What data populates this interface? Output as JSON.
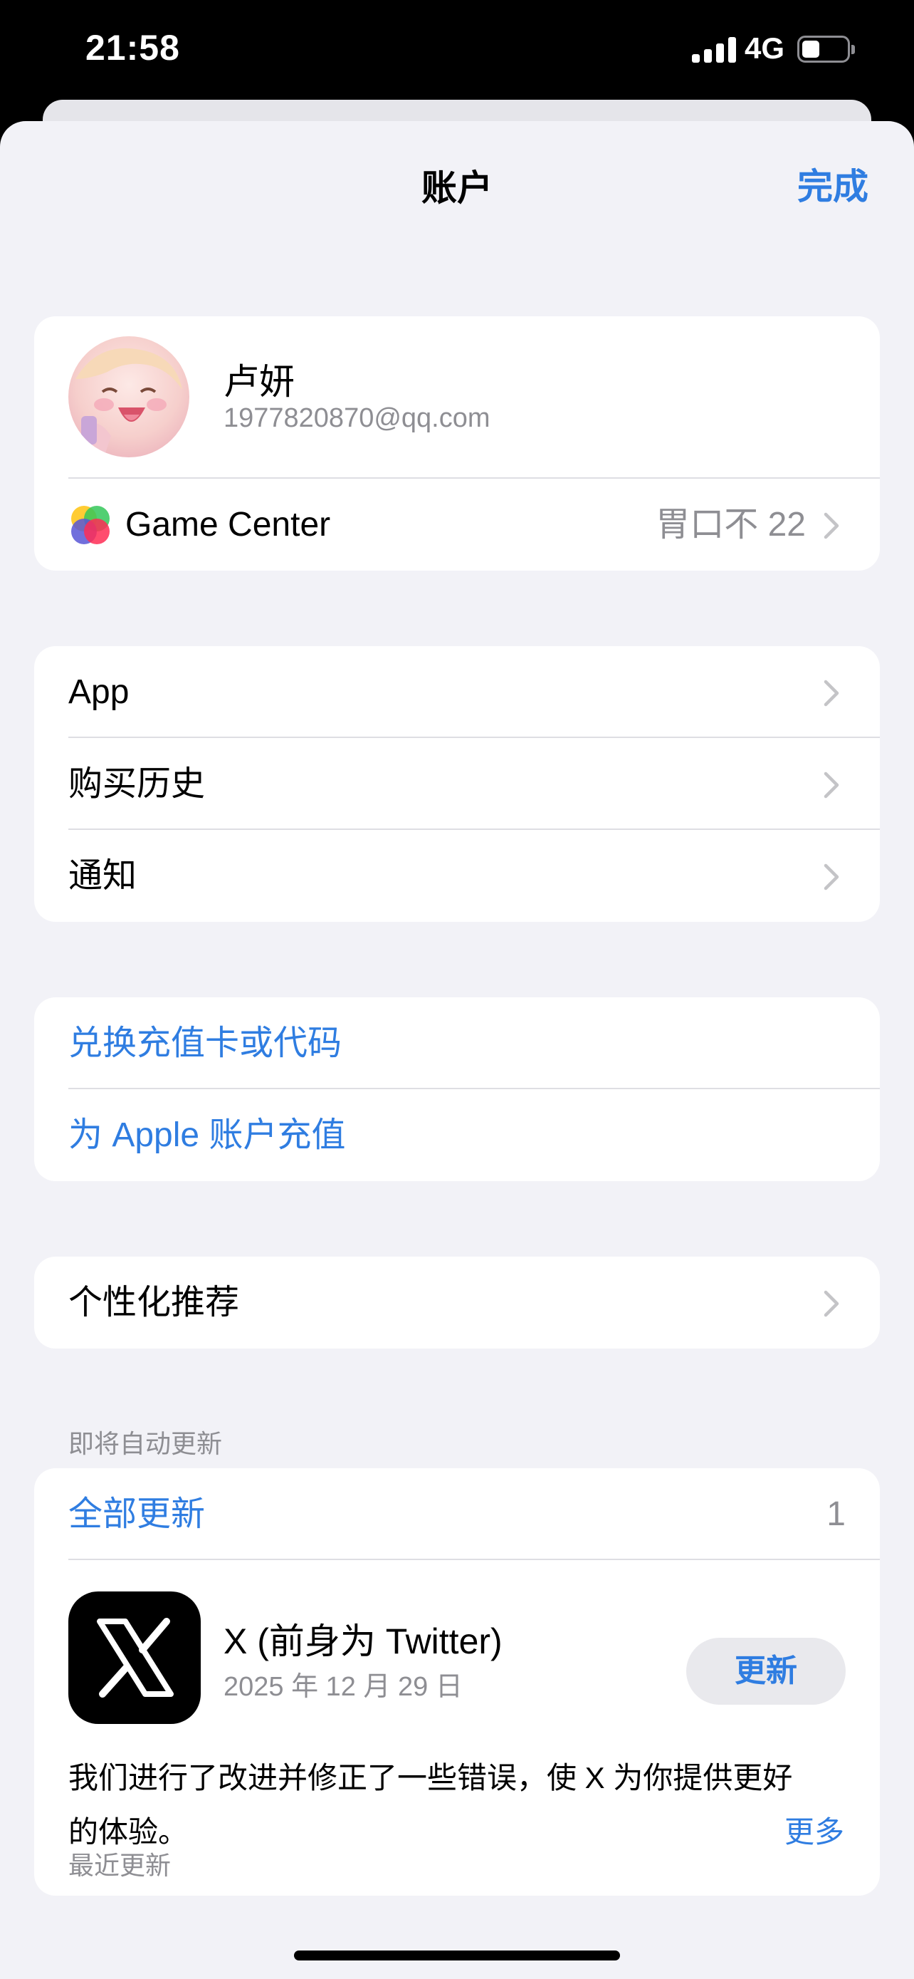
{
  "status_bar": {
    "time": "21:58",
    "network": "4G"
  },
  "nav": {
    "title": "账户",
    "done_label": "完成"
  },
  "profile": {
    "name": "卢妍",
    "email": "1977820870@qq.com",
    "game_center_label": "Game Center",
    "game_center_value": "胃口不 22"
  },
  "menu": {
    "apps": "App",
    "purchase_history": "购买历史",
    "notifications": "通知"
  },
  "wallet": {
    "redeem": "兑换充值卡或代码",
    "add_funds": "为 Apple 账户充值"
  },
  "personalization": {
    "label": "个性化推荐"
  },
  "updates": {
    "section_title": "即将自动更新",
    "update_all": "全部更新",
    "count": "1",
    "app_name": "X (前身为 Twitter)",
    "app_date": "2025 年 12 月 29 日",
    "update_button": "更新",
    "notes": "我们进行了改进并修正了一些错误，使 X 为你提供更好的体验。",
    "more": "更多"
  },
  "recent_section": "最近更新",
  "colors": {
    "accent": "#2f7de1",
    "secondary_text": "#8e8e93",
    "background": "#f2f2f7"
  }
}
